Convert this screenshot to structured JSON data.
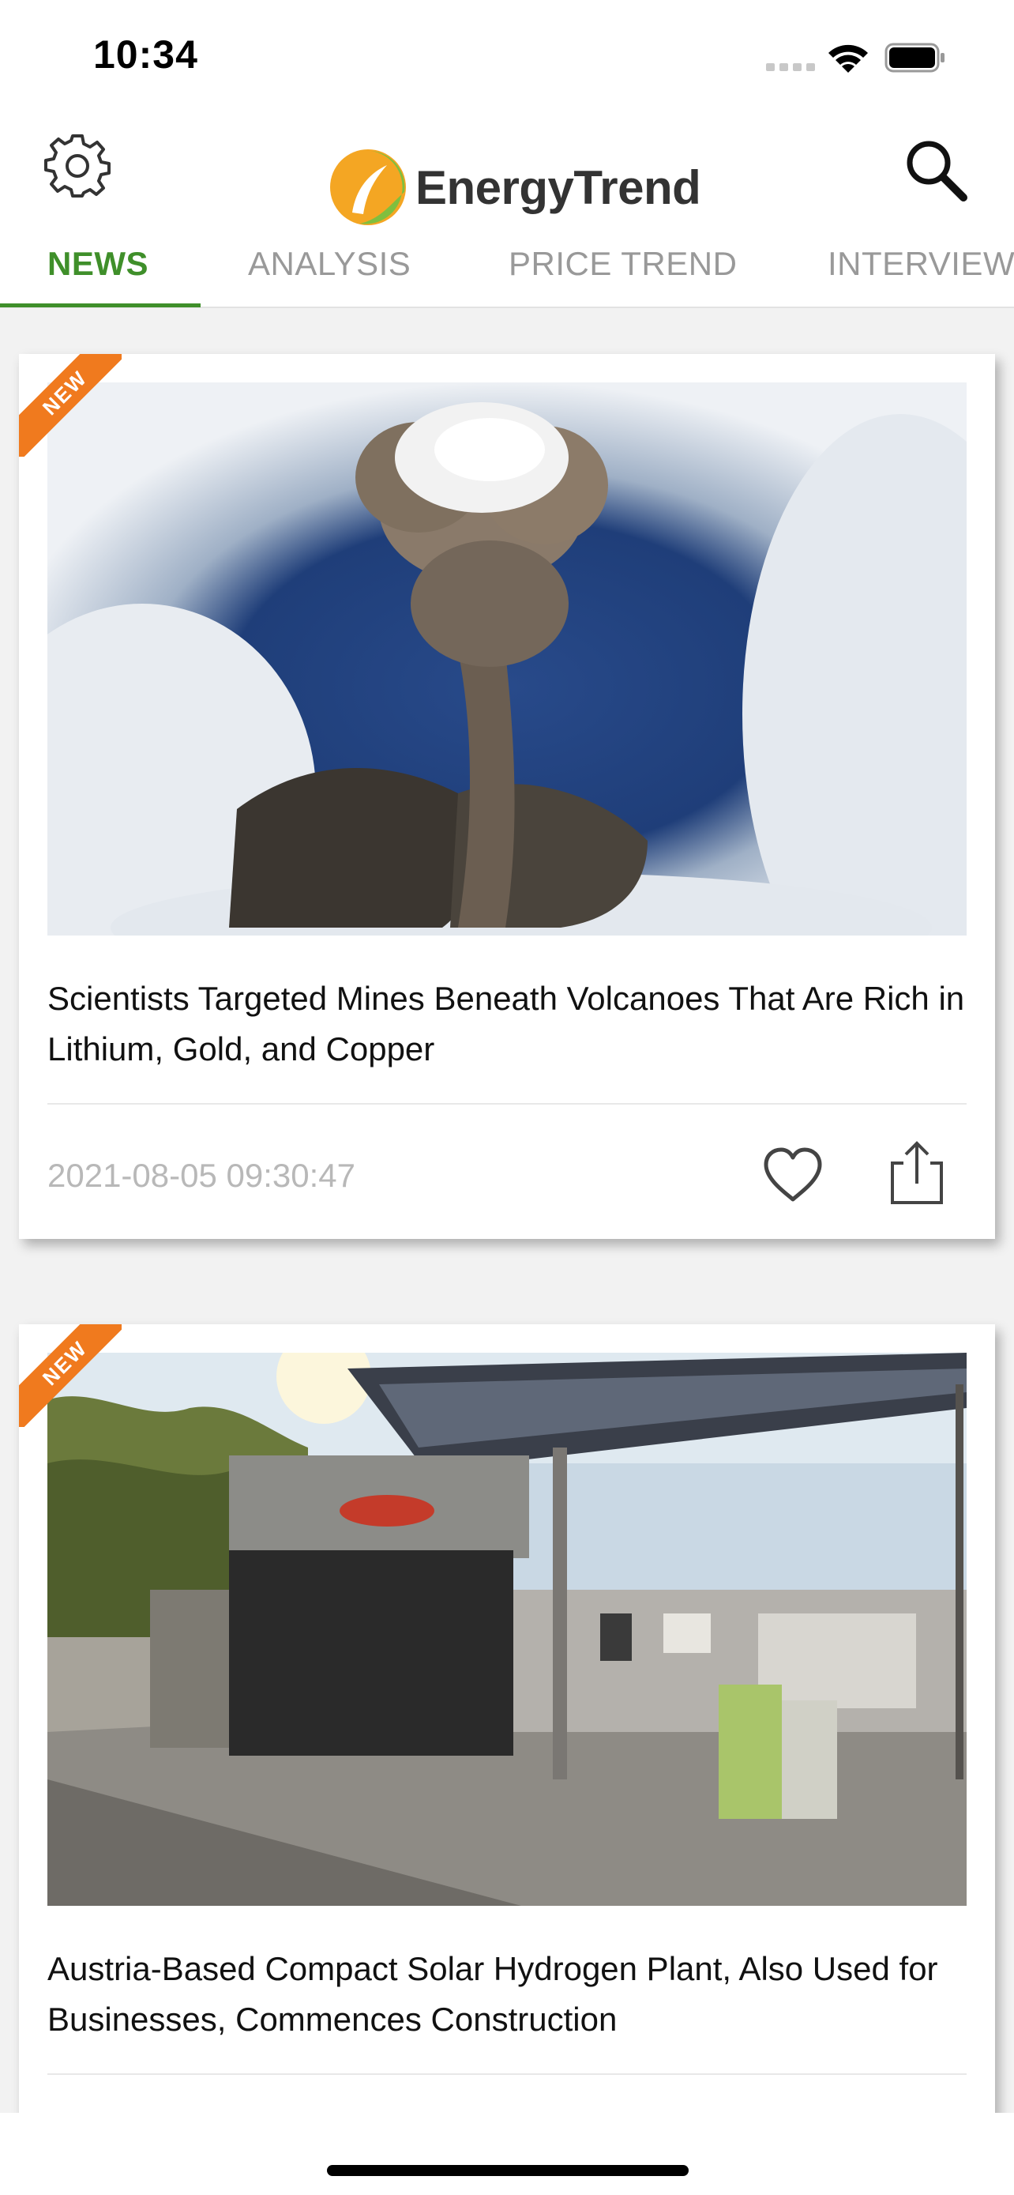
{
  "status_bar": {
    "time": "10:34"
  },
  "header": {
    "logo_text": "EnergyTrend",
    "icons": {
      "settings": "gear-icon",
      "search": "search-icon"
    }
  },
  "tabs": [
    {
      "label": "NEWS",
      "active": true
    },
    {
      "label": "ANALYSIS",
      "active": false
    },
    {
      "label": "PRICE TREND",
      "active": false
    },
    {
      "label": "INTERVIEW",
      "active": false
    }
  ],
  "articles": [
    {
      "badge": "NEW",
      "image": "volcano eruption seen from above through clouds",
      "title": "Scientists Targeted Mines Beneath Volcanoes That Are Rich in Lithium, Gold, and Copper",
      "date": "2021-08-05 09:30:47"
    },
    {
      "badge": "NEW",
      "image": "solar hydrogen plant with fuel dispenser under solar canopy",
      "title": "Austria-Based Compact Solar Hydrogen Plant, Also Used for Businesses, Commences Construction"
    }
  ],
  "colors": {
    "accent": "#3f8f2a",
    "badge": "#f07a1e",
    "inactive_tab": "#999999",
    "date_text": "#b8b8b8"
  }
}
